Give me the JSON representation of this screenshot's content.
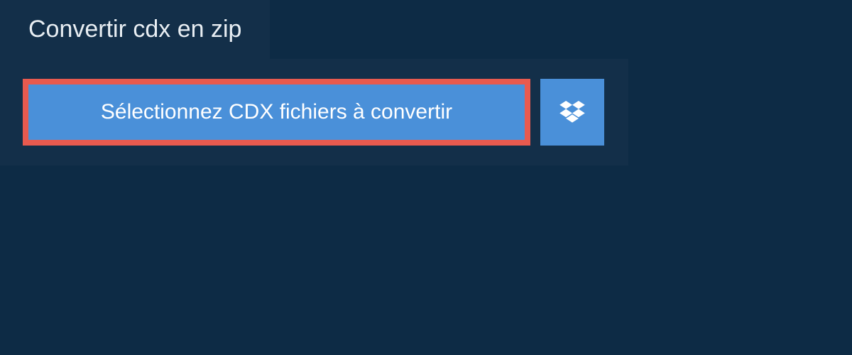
{
  "tab": {
    "label": "Convertir cdx en zip"
  },
  "actions": {
    "select_files_label": "Sélectionnez CDX fichiers à convertir"
  },
  "colors": {
    "background": "#0d2b45",
    "panel": "#132f49",
    "button": "#4a90d9",
    "highlight_border": "#e85a4f",
    "text": "#ffffff"
  }
}
